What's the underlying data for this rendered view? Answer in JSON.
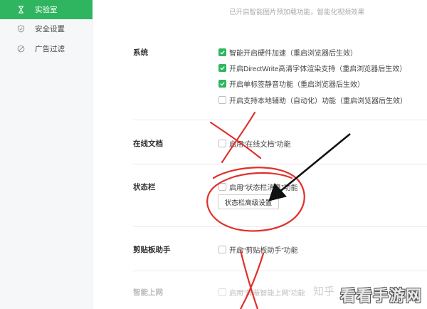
{
  "sidebar": {
    "items": [
      {
        "label": "实验室",
        "icon": "lab-flask-icon",
        "active": true
      },
      {
        "label": "安全设置",
        "icon": "shield-icon",
        "active": false
      },
      {
        "label": "广告过滤",
        "icon": "block-circle-icon",
        "active": false
      }
    ]
  },
  "top_desc": {
    "line1": "",
    "line2": "已开启智能图片预加载功能，智能化视频效果"
  },
  "system": {
    "label": "系统",
    "options": [
      {
        "label": "智能开启硬件加速（重启浏览器后生效）",
        "checked": true
      },
      {
        "label": "开启DirectWrite高清字体渲染支持（重启浏览器后生效）",
        "checked": true
      },
      {
        "label": "开启单标签静音功能（重启浏览器后生效）",
        "checked": true
      },
      {
        "label": "开启支持本地辅助（自动化）功能（重启浏览器后生效）",
        "checked": false
      }
    ]
  },
  "online_docs": {
    "label": "在线文档",
    "option": {
      "label": "启用“在线文档”功能",
      "checked": false
    }
  },
  "status_bar": {
    "label": "状态栏",
    "option": {
      "label": "启用“状态栏消息”功能",
      "checked": false
    },
    "button": "状态栏高级设置"
  },
  "clipboard": {
    "label": "剪贴板助手",
    "option": {
      "label": "开启“剪贴板助手”功能",
      "checked": false
    }
  },
  "smart_net": {
    "label": "智能上网",
    "option": {
      "label": "启用“屏蔽智能上网”功能",
      "checked": false
    }
  },
  "watermark": {
    "small": "知乎",
    "brand": "看看手游网"
  },
  "colors": {
    "accent": "#2fb55f",
    "annotation_red": "#e0302a",
    "arrow": "#111111"
  }
}
